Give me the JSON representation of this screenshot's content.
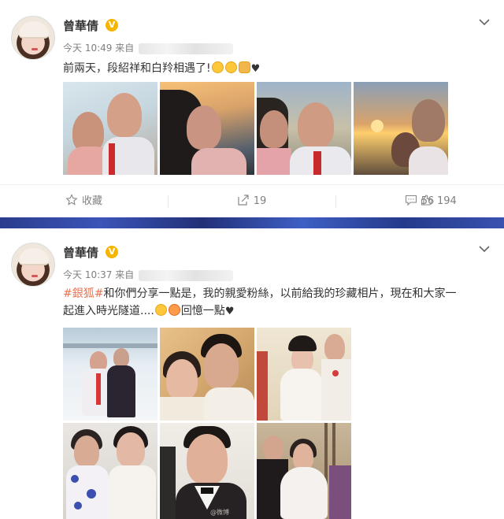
{
  "posts": [
    {
      "username": "曾華倩",
      "verified_badge": "V",
      "time": "今天 10:49",
      "source_prefix": "来自",
      "text": "前兩天，段紹祥和白羚相遇了!",
      "photos": [
        "selfie-couple-1",
        "woman-sunset-profile",
        "selfie-couple-2",
        "selfie-couple-sunset"
      ],
      "actions": {
        "favorite_label": "收藏",
        "share_count": "19",
        "comment_count": "56",
        "like_count": "194"
      }
    },
    {
      "username": "曾華倩",
      "verified_badge": "V",
      "time": "今天 10:37",
      "source_prefix": "来自",
      "hashtag": "#銀狐#",
      "text_line1": "和你們分享一點是，我的親愛粉絲，以前給我的珍藏相片，現在和大家一",
      "text_line2": "起進入時光隧道....",
      "text_end": "回憶一點",
      "photos": [
        "snow-couple",
        "vintage-couple-closeup",
        "wedding-couple",
        "two-women-vintage",
        "young-man-bowtie",
        "couple-fur-coat"
      ],
      "watermark": "@微博"
    }
  ],
  "icons": {
    "dropdown": "chevron-down-icon",
    "favorite": "star-icon",
    "share": "share-icon",
    "comment": "comment-icon",
    "like": "thumbs-up-icon"
  },
  "colors": {
    "hashtag": "#eb7350",
    "verified": "#f7b500",
    "divider": "#2a3c8c"
  }
}
